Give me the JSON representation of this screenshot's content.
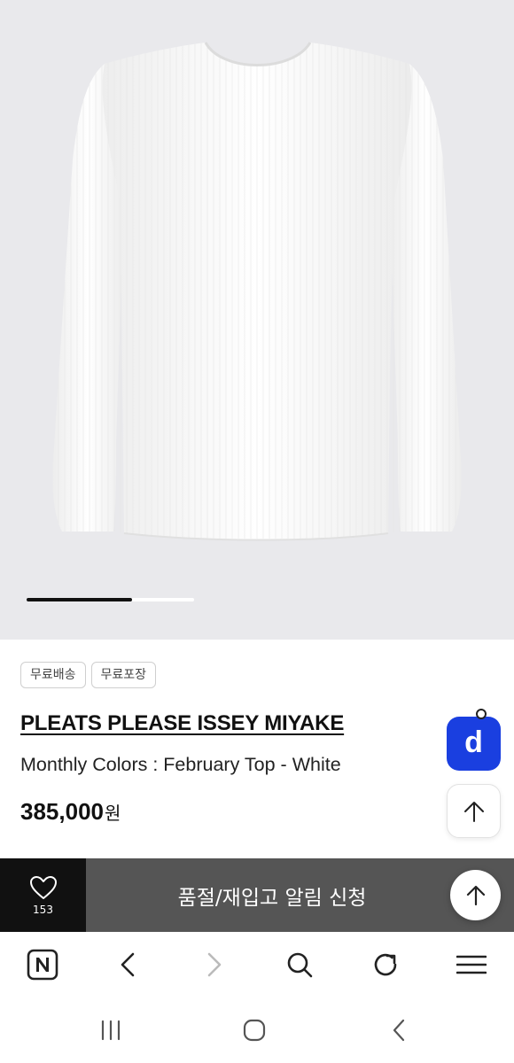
{
  "product_image": {
    "alt": "white pleated long-sleeve top",
    "carousel_progress": 0.63
  },
  "tags": [
    "무료배송",
    "무료포장"
  ],
  "product": {
    "brand": "PLEATS PLEASE ISSEY MIYAKE",
    "name": "Monthly Colors : February Top - White",
    "price": "385,000",
    "currency_unit": "원"
  },
  "floating": {
    "d_button_letter": "d",
    "d_button_color": "#1a3fe0"
  },
  "action_bar": {
    "like_count": "153",
    "restock_label": "품절/재입고 알림 신청",
    "bar_color": "#555555"
  },
  "browser_toolbar": {
    "icons": [
      "naver-n-icon",
      "back-icon",
      "forward-icon",
      "search-icon",
      "refresh-icon",
      "menu-icon"
    ]
  },
  "system_nav": {
    "icons": [
      "recent-apps-icon",
      "home-icon",
      "back-icon"
    ]
  }
}
